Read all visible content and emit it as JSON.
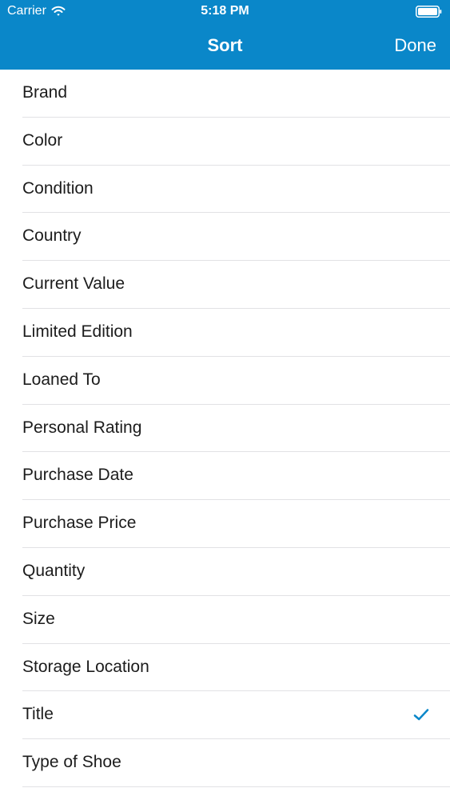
{
  "status_bar": {
    "carrier": "Carrier",
    "time": "5:18 PM",
    "wifi_icon": "wifi-icon",
    "battery_icon": "battery-icon"
  },
  "nav": {
    "title": "Sort",
    "done_label": "Done"
  },
  "colors": {
    "accent": "#0a87c9",
    "checkmark": "#0a87c9",
    "separator": "#e2e2e4",
    "text": "#1c1c1c"
  },
  "sort_options": {
    "items": [
      {
        "label": "Brand",
        "selected": false
      },
      {
        "label": "Color",
        "selected": false
      },
      {
        "label": "Condition",
        "selected": false
      },
      {
        "label": "Country",
        "selected": false
      },
      {
        "label": "Current Value",
        "selected": false
      },
      {
        "label": "Limited Edition",
        "selected": false
      },
      {
        "label": "Loaned To",
        "selected": false
      },
      {
        "label": "Personal Rating",
        "selected": false
      },
      {
        "label": "Purchase Date",
        "selected": false
      },
      {
        "label": "Purchase Price",
        "selected": false
      },
      {
        "label": "Quantity",
        "selected": false
      },
      {
        "label": "Size",
        "selected": false
      },
      {
        "label": "Storage Location",
        "selected": false
      },
      {
        "label": "Title",
        "selected": true,
        "icon": "checkmark-icon"
      },
      {
        "label": "Type of Shoe",
        "selected": false
      }
    ]
  }
}
